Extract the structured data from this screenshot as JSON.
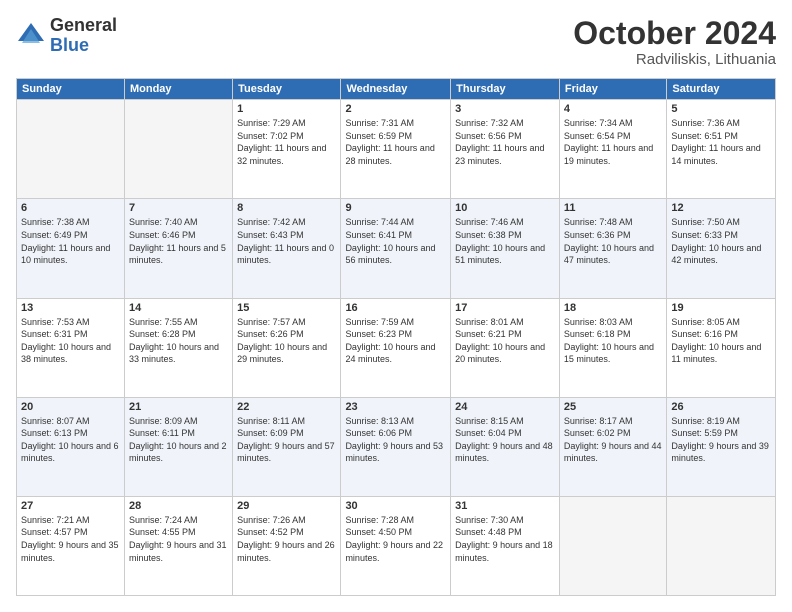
{
  "logo": {
    "general": "General",
    "blue": "Blue"
  },
  "header": {
    "month": "October 2024",
    "location": "Radviliskis, Lithuania"
  },
  "weekdays": [
    "Sunday",
    "Monday",
    "Tuesday",
    "Wednesday",
    "Thursday",
    "Friday",
    "Saturday"
  ],
  "weeks": [
    [
      {
        "day": "",
        "sunrise": "",
        "sunset": "",
        "daylight": ""
      },
      {
        "day": "",
        "sunrise": "",
        "sunset": "",
        "daylight": ""
      },
      {
        "day": "1",
        "sunrise": "Sunrise: 7:29 AM",
        "sunset": "Sunset: 7:02 PM",
        "daylight": "Daylight: 11 hours and 32 minutes."
      },
      {
        "day": "2",
        "sunrise": "Sunrise: 7:31 AM",
        "sunset": "Sunset: 6:59 PM",
        "daylight": "Daylight: 11 hours and 28 minutes."
      },
      {
        "day": "3",
        "sunrise": "Sunrise: 7:32 AM",
        "sunset": "Sunset: 6:56 PM",
        "daylight": "Daylight: 11 hours and 23 minutes."
      },
      {
        "day": "4",
        "sunrise": "Sunrise: 7:34 AM",
        "sunset": "Sunset: 6:54 PM",
        "daylight": "Daylight: 11 hours and 19 minutes."
      },
      {
        "day": "5",
        "sunrise": "Sunrise: 7:36 AM",
        "sunset": "Sunset: 6:51 PM",
        "daylight": "Daylight: 11 hours and 14 minutes."
      }
    ],
    [
      {
        "day": "6",
        "sunrise": "Sunrise: 7:38 AM",
        "sunset": "Sunset: 6:49 PM",
        "daylight": "Daylight: 11 hours and 10 minutes."
      },
      {
        "day": "7",
        "sunrise": "Sunrise: 7:40 AM",
        "sunset": "Sunset: 6:46 PM",
        "daylight": "Daylight: 11 hours and 5 minutes."
      },
      {
        "day": "8",
        "sunrise": "Sunrise: 7:42 AM",
        "sunset": "Sunset: 6:43 PM",
        "daylight": "Daylight: 11 hours and 0 minutes."
      },
      {
        "day": "9",
        "sunrise": "Sunrise: 7:44 AM",
        "sunset": "Sunset: 6:41 PM",
        "daylight": "Daylight: 10 hours and 56 minutes."
      },
      {
        "day": "10",
        "sunrise": "Sunrise: 7:46 AM",
        "sunset": "Sunset: 6:38 PM",
        "daylight": "Daylight: 10 hours and 51 minutes."
      },
      {
        "day": "11",
        "sunrise": "Sunrise: 7:48 AM",
        "sunset": "Sunset: 6:36 PM",
        "daylight": "Daylight: 10 hours and 47 minutes."
      },
      {
        "day": "12",
        "sunrise": "Sunrise: 7:50 AM",
        "sunset": "Sunset: 6:33 PM",
        "daylight": "Daylight: 10 hours and 42 minutes."
      }
    ],
    [
      {
        "day": "13",
        "sunrise": "Sunrise: 7:53 AM",
        "sunset": "Sunset: 6:31 PM",
        "daylight": "Daylight: 10 hours and 38 minutes."
      },
      {
        "day": "14",
        "sunrise": "Sunrise: 7:55 AM",
        "sunset": "Sunset: 6:28 PM",
        "daylight": "Daylight: 10 hours and 33 minutes."
      },
      {
        "day": "15",
        "sunrise": "Sunrise: 7:57 AM",
        "sunset": "Sunset: 6:26 PM",
        "daylight": "Daylight: 10 hours and 29 minutes."
      },
      {
        "day": "16",
        "sunrise": "Sunrise: 7:59 AM",
        "sunset": "Sunset: 6:23 PM",
        "daylight": "Daylight: 10 hours and 24 minutes."
      },
      {
        "day": "17",
        "sunrise": "Sunrise: 8:01 AM",
        "sunset": "Sunset: 6:21 PM",
        "daylight": "Daylight: 10 hours and 20 minutes."
      },
      {
        "day": "18",
        "sunrise": "Sunrise: 8:03 AM",
        "sunset": "Sunset: 6:18 PM",
        "daylight": "Daylight: 10 hours and 15 minutes."
      },
      {
        "day": "19",
        "sunrise": "Sunrise: 8:05 AM",
        "sunset": "Sunset: 6:16 PM",
        "daylight": "Daylight: 10 hours and 11 minutes."
      }
    ],
    [
      {
        "day": "20",
        "sunrise": "Sunrise: 8:07 AM",
        "sunset": "Sunset: 6:13 PM",
        "daylight": "Daylight: 10 hours and 6 minutes."
      },
      {
        "day": "21",
        "sunrise": "Sunrise: 8:09 AM",
        "sunset": "Sunset: 6:11 PM",
        "daylight": "Daylight: 10 hours and 2 minutes."
      },
      {
        "day": "22",
        "sunrise": "Sunrise: 8:11 AM",
        "sunset": "Sunset: 6:09 PM",
        "daylight": "Daylight: 9 hours and 57 minutes."
      },
      {
        "day": "23",
        "sunrise": "Sunrise: 8:13 AM",
        "sunset": "Sunset: 6:06 PM",
        "daylight": "Daylight: 9 hours and 53 minutes."
      },
      {
        "day": "24",
        "sunrise": "Sunrise: 8:15 AM",
        "sunset": "Sunset: 6:04 PM",
        "daylight": "Daylight: 9 hours and 48 minutes."
      },
      {
        "day": "25",
        "sunrise": "Sunrise: 8:17 AM",
        "sunset": "Sunset: 6:02 PM",
        "daylight": "Daylight: 9 hours and 44 minutes."
      },
      {
        "day": "26",
        "sunrise": "Sunrise: 8:19 AM",
        "sunset": "Sunset: 5:59 PM",
        "daylight": "Daylight: 9 hours and 39 minutes."
      }
    ],
    [
      {
        "day": "27",
        "sunrise": "Sunrise: 7:21 AM",
        "sunset": "Sunset: 4:57 PM",
        "daylight": "Daylight: 9 hours and 35 minutes."
      },
      {
        "day": "28",
        "sunrise": "Sunrise: 7:24 AM",
        "sunset": "Sunset: 4:55 PM",
        "daylight": "Daylight: 9 hours and 31 minutes."
      },
      {
        "day": "29",
        "sunrise": "Sunrise: 7:26 AM",
        "sunset": "Sunset: 4:52 PM",
        "daylight": "Daylight: 9 hours and 26 minutes."
      },
      {
        "day": "30",
        "sunrise": "Sunrise: 7:28 AM",
        "sunset": "Sunset: 4:50 PM",
        "daylight": "Daylight: 9 hours and 22 minutes."
      },
      {
        "day": "31",
        "sunrise": "Sunrise: 7:30 AM",
        "sunset": "Sunset: 4:48 PM",
        "daylight": "Daylight: 9 hours and 18 minutes."
      },
      {
        "day": "",
        "sunrise": "",
        "sunset": "",
        "daylight": ""
      },
      {
        "day": "",
        "sunrise": "",
        "sunset": "",
        "daylight": ""
      }
    ]
  ]
}
